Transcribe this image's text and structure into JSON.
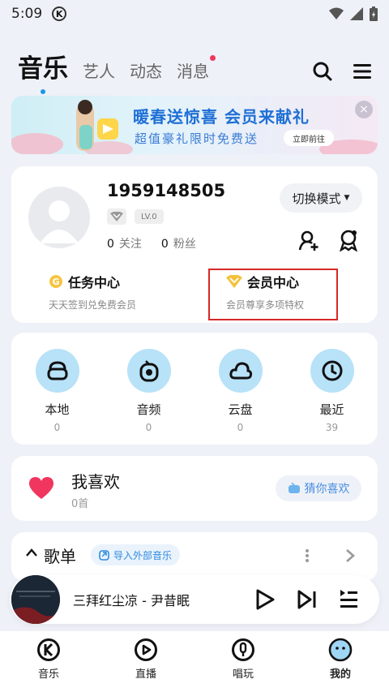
{
  "status_bar": {
    "time": "5:09",
    "badge": "K"
  },
  "top_nav": {
    "active_tab": "音乐",
    "tabs": [
      "艺人",
      "动态",
      "消息"
    ]
  },
  "banner": {
    "title": "暖春送惊喜 会员来献礼",
    "subtitle": "超值豪礼限时免费送",
    "cta": "立即前往",
    "close": "×"
  },
  "profile": {
    "username": "1959148505",
    "level": "LV.0",
    "following_count": "0",
    "following_label": "关注",
    "fans_count": "0",
    "fans_label": "粉丝",
    "mode_button": "切换模式",
    "task_center": {
      "title": "任务中心",
      "subtitle": "天天签到兑免费会员"
    },
    "vip_center": {
      "title": "会员中心",
      "subtitle": "会员尊享多项特权"
    }
  },
  "quick_access": [
    {
      "label": "本地",
      "count": "0",
      "icon": "box-icon"
    },
    {
      "label": "音频",
      "count": "0",
      "icon": "radio-icon"
    },
    {
      "label": "云盘",
      "count": "0",
      "icon": "cloud-icon"
    },
    {
      "label": "最近",
      "count": "39",
      "icon": "clock-icon"
    }
  ],
  "favorites": {
    "title": "我喜欢",
    "count": "0首",
    "guess_button": "猜你喜欢"
  },
  "playlists": {
    "title": "歌单",
    "import_button": "导入外部音乐"
  },
  "mini_player": {
    "song": "三拜红尘凉  -  尹昔眠"
  },
  "bottom_nav": [
    {
      "label": "音乐",
      "icon": "k-logo-icon"
    },
    {
      "label": "直播",
      "icon": "live-play-icon"
    },
    {
      "label": "唱玩",
      "icon": "mic-icon"
    },
    {
      "label": "我的",
      "icon": "profile-face-icon",
      "active": true
    }
  ],
  "colors": {
    "accent": "#1c97e8",
    "quick_circle": "#b7e2f8",
    "heart": "#f0365e",
    "highlight_box": "#d62828"
  }
}
